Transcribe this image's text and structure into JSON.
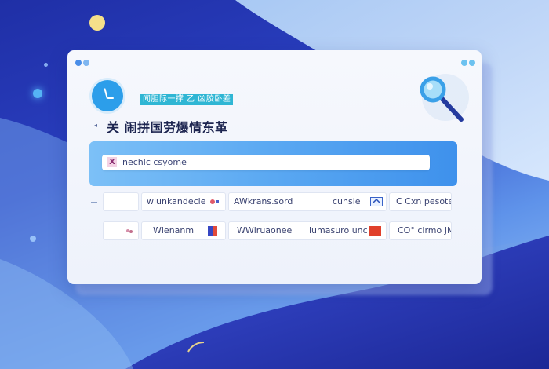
{
  "card": {
    "badge": "闻胆际一撑 乙 凶胶卧差",
    "title": "关 闹拼国劳爆情东革",
    "back_arrow": "◂"
  },
  "search": {
    "value": "nechlc csyome",
    "icon_glyph": "X"
  },
  "rows": [
    {
      "c1": "",
      "c2": "wlunkandecie",
      "c3": "AWkrans.sord",
      "c4": "cunsle",
      "c5": "C Cxn pesote"
    },
    {
      "c1": "",
      "c2": "Wlenanm",
      "c3": "WWlruaonee",
      "c4": "lumasuro unc",
      "c5": "CO° cirmo JMI"
    }
  ],
  "colors": {
    "accent": "#2c9eea",
    "band_start": "#7cc0f7",
    "band_end": "#3e91ec",
    "badge": "#2fb6d4"
  }
}
